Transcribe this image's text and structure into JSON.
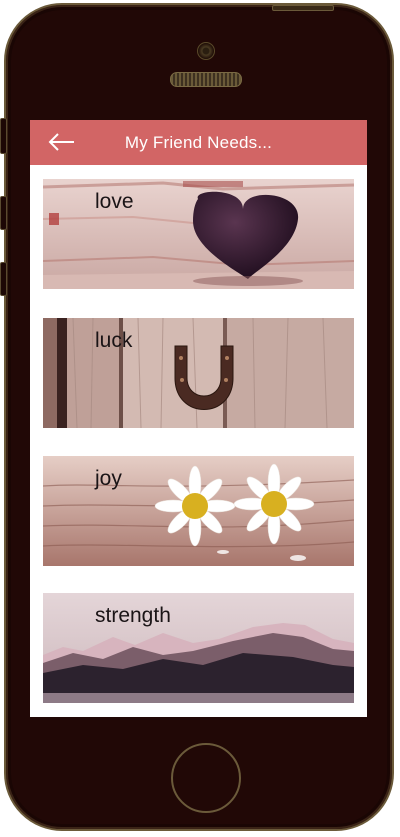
{
  "app": {
    "title": "My Friend Needs..."
  },
  "cards": [
    {
      "label": "love",
      "image": "heart-image"
    },
    {
      "label": "luck",
      "image": "horseshoe-image"
    },
    {
      "label": "joy",
      "image": "daisies-image"
    },
    {
      "label": "strength",
      "image": "mountains-image"
    }
  ],
  "colors": {
    "appbar": "#d26565",
    "device": "#210806"
  }
}
